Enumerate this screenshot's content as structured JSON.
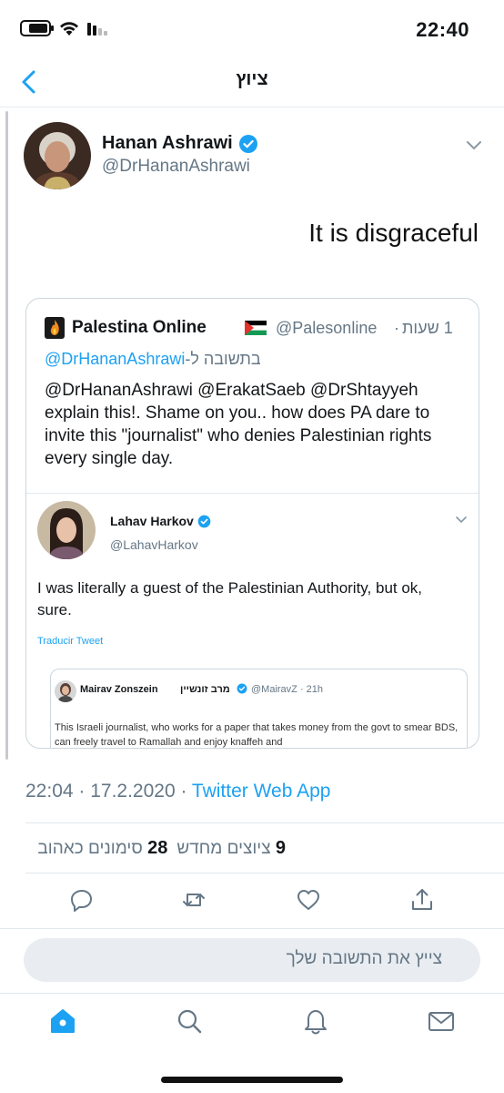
{
  "status_bar": {
    "time": "22:40",
    "battery_level": 0.75,
    "icons": [
      "battery-icon",
      "wifi-icon",
      "signal-icon"
    ]
  },
  "header": {
    "title": "ציוץ",
    "back_icon": "chevron-left-icon"
  },
  "tweet": {
    "author_name": "Hanan Ashrawi",
    "author_handle": "@DrHananAshrawi",
    "verified": true,
    "text": "It is disgraceful",
    "timestamp": "22:04 · 17.2.2020 · ",
    "source_app": "Twitter Web App",
    "retweets_count": "9",
    "retweets_label": "ציוצים מחדש",
    "likes_count": "28",
    "likes_label": "סימונים כאהוב"
  },
  "quoted_tweet": {
    "author_name": "Palestina Online",
    "author_handle": "@Palesonline",
    "separator": "·",
    "time": "1 שעות",
    "reply_prefix": "בתשובה ל-",
    "reply_handle": "@DrHananAshrawi",
    "text": "@DrHananAshrawi @ErakatSaeb @DrShtayyeh explain this!. Shame on you.. how does PA dare to invite this \"journalist\" who denies Palestinian rights every single day."
  },
  "inner_tweet": {
    "author_name": "Lahav Harkov",
    "author_handle": "@LahavHarkov",
    "text": "I was literally a guest of the Palestinian Authority, but ok, sure.",
    "translate_label": "Traducir Tweet"
  },
  "nested_quote": {
    "author_name": "Mairav Zonszein",
    "author_name_he": "מרב זונשיין",
    "author_handle": "@MairavZ · 21h",
    "text": "This Israeli journalist, who works for a paper that takes money from the govt to smear BDS, can freely travel to Ramallah and enjoy knaffeh and"
  },
  "actions": [
    "reply-icon",
    "retweet-icon",
    "like-icon",
    "share-icon"
  ],
  "reply_box": {
    "placeholder": "צייץ את התשובה שלך"
  },
  "tab_bar": [
    "home-icon",
    "search-icon",
    "notifications-icon",
    "messages-icon"
  ],
  "colors": {
    "accent": "#1da1f2",
    "secondary_text": "#657786",
    "divider": "#e1e8ed"
  }
}
